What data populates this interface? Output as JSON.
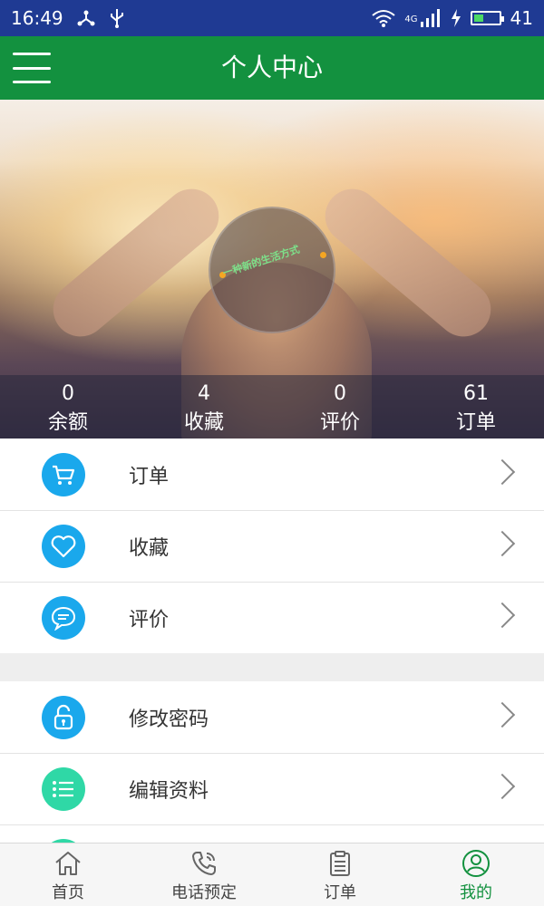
{
  "status_bar": {
    "time": "16:49",
    "network": "4G",
    "battery": "41",
    "battery_level": 0.41
  },
  "header": {
    "title": "个人中心",
    "menu_icon": "hamburger-menu-icon"
  },
  "banner": {
    "slogan": "一种新的生活方式",
    "stats": [
      {
        "value": "0",
        "label": "余额"
      },
      {
        "value": "4",
        "label": "收藏"
      },
      {
        "value": "0",
        "label": "评价"
      },
      {
        "value": "61",
        "label": "订单"
      }
    ]
  },
  "menu_group_1": [
    {
      "label": "订单",
      "icon": "cart-icon",
      "color": "#1aa8ec"
    },
    {
      "label": "收藏",
      "icon": "heart-icon",
      "color": "#1aa8ec"
    },
    {
      "label": "评价",
      "icon": "chat-bubble-icon",
      "color": "#1aa8ec"
    }
  ],
  "menu_group_2": [
    {
      "label": "修改密码",
      "icon": "unlock-icon",
      "color": "#1aa8ec"
    },
    {
      "label": "编辑资料",
      "icon": "list-icon",
      "color": "#2fd8a6"
    }
  ],
  "tabbar": {
    "tabs": [
      {
        "label": "首页",
        "icon": "home-icon"
      },
      {
        "label": "电话预定",
        "icon": "phone-icon"
      },
      {
        "label": "订单",
        "icon": "clipboard-icon"
      },
      {
        "label": "我的",
        "icon": "user-icon"
      }
    ],
    "active": "我的"
  },
  "colors": {
    "status_bar": "#1f3a93",
    "header": "#13913f",
    "accent_blue": "#1aa8ec",
    "accent_teal": "#2fd8a6"
  }
}
